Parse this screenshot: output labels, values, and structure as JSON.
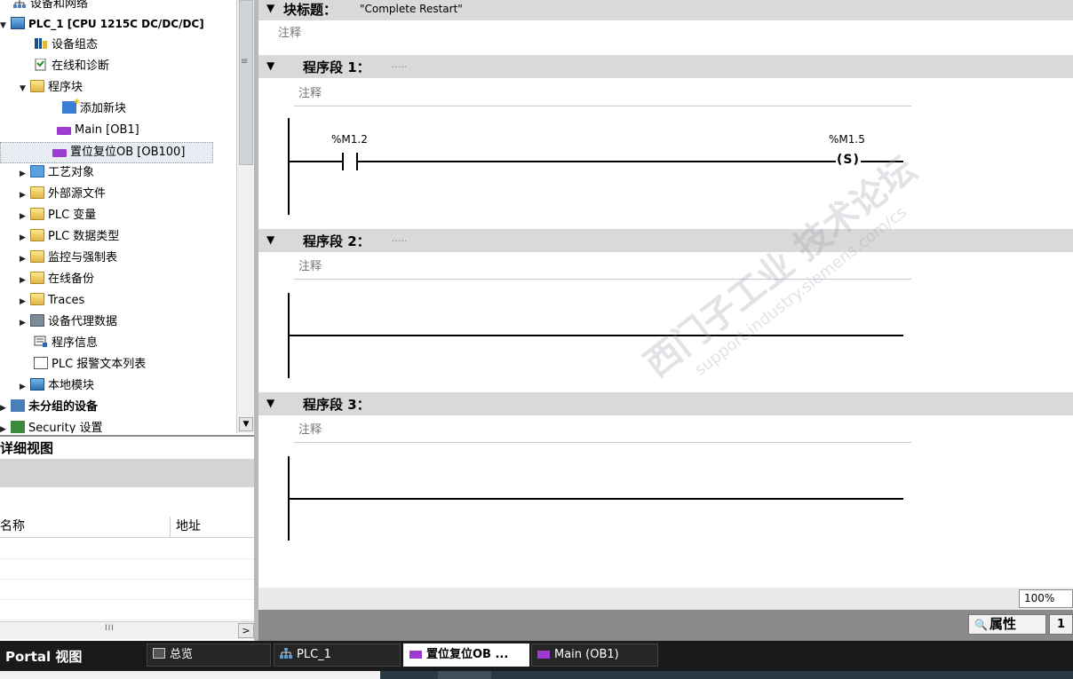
{
  "tree": {
    "items": [
      {
        "label": "设备和网络",
        "indent": 0
      },
      {
        "label": "PLC_1 [CPU 1215C DC/DC/DC]",
        "indent": 0
      },
      {
        "label": "设备组态",
        "indent": 2
      },
      {
        "label": "在线和诊断",
        "indent": 2
      },
      {
        "label": "程序块",
        "indent": 1
      },
      {
        "label": "添加新块",
        "indent": 3
      },
      {
        "label": "Main [OB1]",
        "indent": 3
      },
      {
        "label": "置位复位OB [OB100]",
        "indent": 3
      },
      {
        "label": "工艺对象",
        "indent": 1
      },
      {
        "label": "外部源文件",
        "indent": 1
      },
      {
        "label": "PLC 变量",
        "indent": 1
      },
      {
        "label": "PLC 数据类型",
        "indent": 1
      },
      {
        "label": "监控与强制表",
        "indent": 1
      },
      {
        "label": "在线备份",
        "indent": 1
      },
      {
        "label": "Traces",
        "indent": 1
      },
      {
        "label": "设备代理数据",
        "indent": 1
      },
      {
        "label": "程序信息",
        "indent": 2
      },
      {
        "label": "PLC 报警文本列表",
        "indent": 2
      },
      {
        "label": "本地模块",
        "indent": 1
      },
      {
        "label": "未分组的设备",
        "indent": 0
      },
      {
        "label": "Security 设置",
        "indent": 0
      }
    ]
  },
  "detail_view": {
    "title": "详细视图",
    "col_name": "名称",
    "col_address": "地址"
  },
  "editor": {
    "block_title_label": "块标题：",
    "block_title_value": "\"Complete Restart\"",
    "block_comment": "注释",
    "networks": [
      {
        "title": "程序段 1：",
        "dots": ".....",
        "comment": "注释",
        "contact_operand": "%M1.2",
        "coil_operand": "%M1.5",
        "coil_symbol": "S"
      },
      {
        "title": "程序段 2：",
        "dots": ".....",
        "comment": "注释"
      },
      {
        "title": "程序段 3：",
        "dots": "",
        "comment": "注释"
      }
    ],
    "zoom": "100%",
    "properties_tab": "属性",
    "pin_icon_text": "1"
  },
  "taskbar": {
    "portal_label": "Portal 视图",
    "tasks": [
      {
        "label": "总览",
        "icon": "overview-icon"
      },
      {
        "label": "PLC_1",
        "icon": "network-icon"
      },
      {
        "label": "置位复位OB ...",
        "icon": "block-icon"
      },
      {
        "label": "Main (OB1)",
        "icon": "block-icon"
      }
    ]
  },
  "watermark": {
    "text_cn": "西门子工业 技术论坛",
    "text_url": "support.industry.siemens.com/cs"
  },
  "colors": {
    "section_bar": "#d9d9d9",
    "block_purple": "#9b3bd1",
    "taskbar_bg": "#1a1a1a",
    "selected_bg": "#e8edf3"
  }
}
